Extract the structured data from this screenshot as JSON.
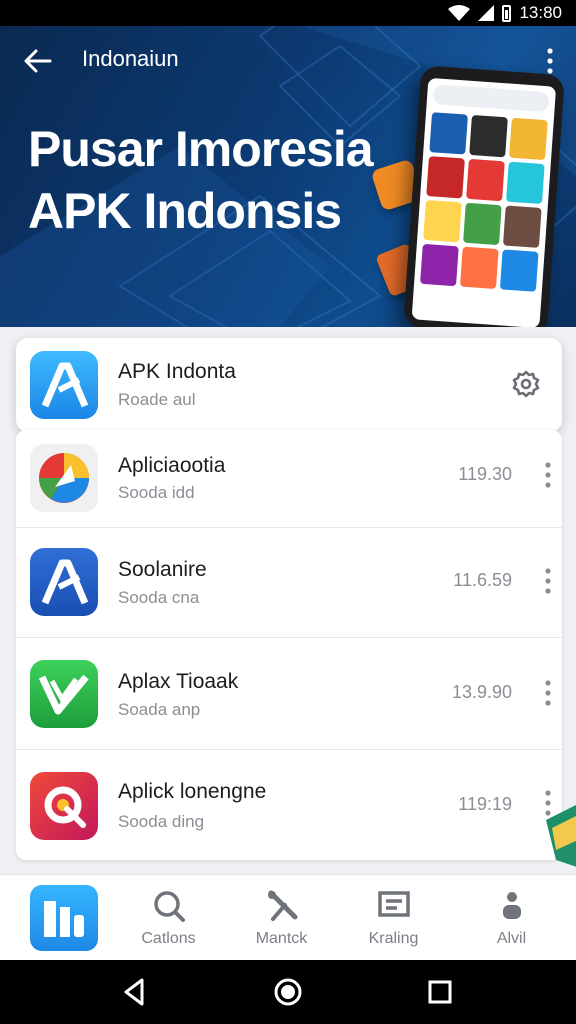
{
  "status_bar": {
    "time": "13:80"
  },
  "header": {
    "title": "Indonaiun",
    "headline_line1": "Pusar Imoresia",
    "headline_line2": "APK Indonsis"
  },
  "featured": {
    "name": "APK Indonta",
    "subtitle": "Roade aul"
  },
  "apps": [
    {
      "name": "Apliciaootia",
      "subtitle": "Sooda idd",
      "time": "119.30",
      "icon": "compass-app-icon"
    },
    {
      "name": "Soolanire",
      "subtitle": "Sooda cna",
      "time": "11.6.59",
      "icon": "a-store-app-icon"
    },
    {
      "name": "Aplax Tioaak",
      "subtitle": "Soada anp",
      "time": "13.9.90",
      "icon": "check-app-icon"
    },
    {
      "name": "Aplick lonengne",
      "subtitle": "Sooda ding",
      "time": "119:19",
      "icon": "loop-app-icon"
    }
  ],
  "bottom_nav": [
    {
      "label": "",
      "icon": "home-icon"
    },
    {
      "label": "Catlons",
      "icon": "search-icon"
    },
    {
      "label": "Mantck",
      "icon": "tools-icon"
    },
    {
      "label": "Kraling",
      "icon": "ranking-icon"
    },
    {
      "label": "Alvil",
      "icon": "profile-icon"
    }
  ],
  "colors": {
    "accent": "#1e88e5",
    "hero_dark": "#0a2a52",
    "text_secondary": "#8a8e95"
  }
}
